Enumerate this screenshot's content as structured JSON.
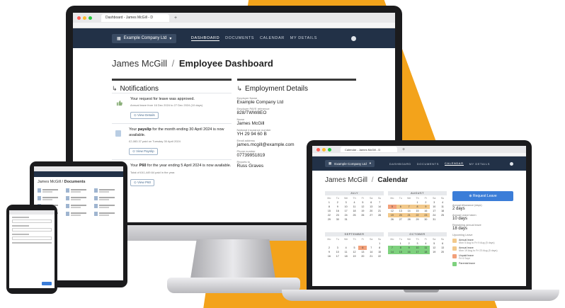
{
  "browser": {
    "tab_title": "Dashboard - James McGill - D",
    "tab_plus": "+",
    "laptop_tab_title": "Calendar - James McGill - D"
  },
  "navbar": {
    "company": "Example Company Ltd",
    "links": [
      "DASHBOARD",
      "DOCUMENTS",
      "CALENDAR",
      "MY DETAILS"
    ]
  },
  "dashboard": {
    "user_name": "James McGill",
    "separator": "/",
    "page_name": "Employee Dashboard",
    "notifications_heading": "Notifications",
    "employment_heading": "Employment Details",
    "notifications": [
      {
        "title_before": "Your request for leave was approved.",
        "title_bold": "",
        "title_after": "",
        "sub": "Annual leave from 16 Dec 2024 to 27 Dec 2024 (10 days)",
        "button": "View Details",
        "icon": "thumbs-up-icon"
      },
      {
        "title_before": "Your ",
        "title_bold": "payslip",
        "title_after": " for the month ending 30 April 2024 is now available.",
        "sub": "£2,083.37 paid on Tuesday 30 April 2024",
        "button": "View Payslip",
        "icon": "document-icon"
      },
      {
        "title_before": "Your ",
        "title_bold": "P60",
        "title_after": " for the year ending 5 April 2024 is now available.",
        "sub": "Total of £41,449.64 paid in the year.",
        "button": "View P60",
        "icon": "document-icon"
      }
    ],
    "employment": [
      {
        "label": "Employer Name",
        "value": "Example Company Ltd"
      },
      {
        "label": "Employer PAYE reference",
        "value": "828/TWW8EO"
      },
      {
        "label": "Name",
        "value": "James McGill"
      },
      {
        "label": "National Insurance number",
        "value": "YH 29 94 60 B"
      },
      {
        "label": "Email address",
        "value": "james.mcgill@example.com"
      },
      {
        "label": "Phone number",
        "value": "07739951819"
      },
      {
        "label": "Reports to",
        "value": "Russ Graves"
      }
    ]
  },
  "calendar": {
    "user_name": "James McGill",
    "separator": "/",
    "page_name": "Calendar",
    "request_button": "Request Leave",
    "months": [
      {
        "name": "JULY",
        "highlight": []
      },
      {
        "name": "AUGUST",
        "highlight": []
      },
      {
        "name": "SEPTEMBER",
        "highlight": []
      },
      {
        "name": "OCTOBER",
        "highlight": []
      }
    ],
    "weekdays": [
      "Mon",
      "Tue",
      "Wed",
      "Thu",
      "Fri",
      "Sat",
      "Sun"
    ],
    "july": [
      "1",
      "2",
      "3",
      "4",
      "5",
      "6",
      "7",
      "8",
      "9",
      "10",
      "11",
      "12",
      "13",
      "14",
      "15",
      "16",
      "17",
      "18",
      "19",
      "20",
      "21",
      "22",
      "23",
      "24",
      "25",
      "26",
      "27",
      "28",
      "29",
      "30",
      "31"
    ],
    "august": [
      "",
      "",
      "",
      "1",
      "2",
      "3",
      "4",
      "5",
      "6",
      "7",
      "8",
      "9",
      "10",
      "11",
      "12",
      "13",
      "14",
      "15",
      "16",
      "17",
      "18",
      "19",
      "20",
      "21",
      "22",
      "23",
      "24",
      "25",
      "26",
      "27",
      "28",
      "29",
      "30",
      "31"
    ],
    "september": [
      "",
      "",
      "",
      "",
      "",
      "",
      "1",
      "2",
      "3",
      "4",
      "5",
      "6",
      "7",
      "8",
      "9",
      "10",
      "11",
      "12",
      "13",
      "14",
      "15",
      "16",
      "17",
      "18",
      "19",
      "20",
      "21",
      "22"
    ],
    "october": [
      "",
      "1",
      "2",
      "3",
      "4",
      "5",
      "6",
      "7",
      "8",
      "9",
      "10",
      "11",
      "12",
      "13",
      "14",
      "15",
      "16",
      "17",
      "18",
      "19",
      "20"
    ],
    "side": [
      {
        "label": "Annual Allowance (days)",
        "value": "2 days"
      },
      {
        "label": "Annual Leave taken",
        "value": "10 days"
      },
      {
        "label": "Remaining annual leave",
        "value": "18 days"
      }
    ],
    "upcoming_label": "Upcoming Leave",
    "leave_items": [
      {
        "title": "Annual leave",
        "dates": "Mon 5 Aug to Fri 9 Aug (5 days)",
        "color": "#f2c98b"
      },
      {
        "title": "Annual leave",
        "dates": "Mon 19 Aug to Fri 23 Aug (5 days)",
        "color": "#f2c98b"
      },
      {
        "title": "Unpaid leave",
        "dates": "Fri 6 Sept",
        "color": "#f2a07a"
      },
      {
        "title": "Parental leave",
        "dates": "",
        "color": "#7ed17e"
      }
    ]
  },
  "tablet": {
    "user_name": "James McGill",
    "page_name": "Documents"
  },
  "colors": {
    "navy": "#223147",
    "accent_orange": "#f3a31b",
    "request_blue": "#3b7dd8"
  }
}
